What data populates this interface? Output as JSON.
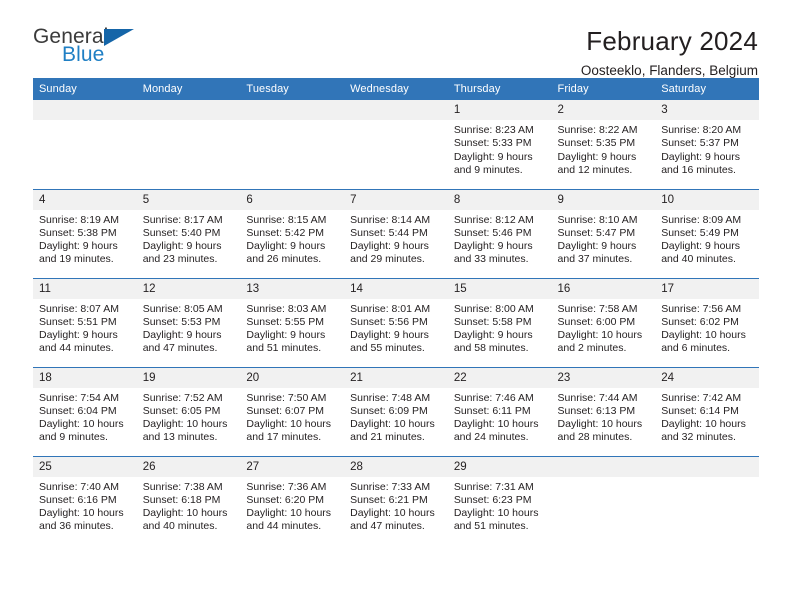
{
  "brand": {
    "name_top": "General",
    "name_bottom": "Blue",
    "flag_icon": "triangle-flag-icon",
    "color_blue": "#1f7fc4",
    "color_flag": "#1565a8"
  },
  "header": {
    "title": "February 2024",
    "subtitle": "Oosteeklo, Flanders, Belgium"
  },
  "theme": {
    "header_row_bg": "#3175b8",
    "daynum_bg": "#f1f1f1",
    "text": "#231f20"
  },
  "weekday_headers": [
    "Sunday",
    "Monday",
    "Tuesday",
    "Wednesday",
    "Thursday",
    "Friday",
    "Saturday"
  ],
  "labels": {
    "sunrise": "Sunrise:",
    "sunset": "Sunset:",
    "daylight": "Daylight:"
  },
  "weeks": [
    [
      {
        "day": "",
        "sunrise": "",
        "sunset": "",
        "daylight_line1": "",
        "daylight_line2": ""
      },
      {
        "day": "",
        "sunrise": "",
        "sunset": "",
        "daylight_line1": "",
        "daylight_line2": ""
      },
      {
        "day": "",
        "sunrise": "",
        "sunset": "",
        "daylight_line1": "",
        "daylight_line2": ""
      },
      {
        "day": "",
        "sunrise": "",
        "sunset": "",
        "daylight_line1": "",
        "daylight_line2": ""
      },
      {
        "day": "1",
        "sunrise": "Sunrise: 8:23 AM",
        "sunset": "Sunset: 5:33 PM",
        "daylight_line1": "Daylight: 9 hours",
        "daylight_line2": "and 9 minutes."
      },
      {
        "day": "2",
        "sunrise": "Sunrise: 8:22 AM",
        "sunset": "Sunset: 5:35 PM",
        "daylight_line1": "Daylight: 9 hours",
        "daylight_line2": "and 12 minutes."
      },
      {
        "day": "3",
        "sunrise": "Sunrise: 8:20 AM",
        "sunset": "Sunset: 5:37 PM",
        "daylight_line1": "Daylight: 9 hours",
        "daylight_line2": "and 16 minutes."
      }
    ],
    [
      {
        "day": "4",
        "sunrise": "Sunrise: 8:19 AM",
        "sunset": "Sunset: 5:38 PM",
        "daylight_line1": "Daylight: 9 hours",
        "daylight_line2": "and 19 minutes."
      },
      {
        "day": "5",
        "sunrise": "Sunrise: 8:17 AM",
        "sunset": "Sunset: 5:40 PM",
        "daylight_line1": "Daylight: 9 hours",
        "daylight_line2": "and 23 minutes."
      },
      {
        "day": "6",
        "sunrise": "Sunrise: 8:15 AM",
        "sunset": "Sunset: 5:42 PM",
        "daylight_line1": "Daylight: 9 hours",
        "daylight_line2": "and 26 minutes."
      },
      {
        "day": "7",
        "sunrise": "Sunrise: 8:14 AM",
        "sunset": "Sunset: 5:44 PM",
        "daylight_line1": "Daylight: 9 hours",
        "daylight_line2": "and 29 minutes."
      },
      {
        "day": "8",
        "sunrise": "Sunrise: 8:12 AM",
        "sunset": "Sunset: 5:46 PM",
        "daylight_line1": "Daylight: 9 hours",
        "daylight_line2": "and 33 minutes."
      },
      {
        "day": "9",
        "sunrise": "Sunrise: 8:10 AM",
        "sunset": "Sunset: 5:47 PM",
        "daylight_line1": "Daylight: 9 hours",
        "daylight_line2": "and 37 minutes."
      },
      {
        "day": "10",
        "sunrise": "Sunrise: 8:09 AM",
        "sunset": "Sunset: 5:49 PM",
        "daylight_line1": "Daylight: 9 hours",
        "daylight_line2": "and 40 minutes."
      }
    ],
    [
      {
        "day": "11",
        "sunrise": "Sunrise: 8:07 AM",
        "sunset": "Sunset: 5:51 PM",
        "daylight_line1": "Daylight: 9 hours",
        "daylight_line2": "and 44 minutes."
      },
      {
        "day": "12",
        "sunrise": "Sunrise: 8:05 AM",
        "sunset": "Sunset: 5:53 PM",
        "daylight_line1": "Daylight: 9 hours",
        "daylight_line2": "and 47 minutes."
      },
      {
        "day": "13",
        "sunrise": "Sunrise: 8:03 AM",
        "sunset": "Sunset: 5:55 PM",
        "daylight_line1": "Daylight: 9 hours",
        "daylight_line2": "and 51 minutes."
      },
      {
        "day": "14",
        "sunrise": "Sunrise: 8:01 AM",
        "sunset": "Sunset: 5:56 PM",
        "daylight_line1": "Daylight: 9 hours",
        "daylight_line2": "and 55 minutes."
      },
      {
        "day": "15",
        "sunrise": "Sunrise: 8:00 AM",
        "sunset": "Sunset: 5:58 PM",
        "daylight_line1": "Daylight: 9 hours",
        "daylight_line2": "and 58 minutes."
      },
      {
        "day": "16",
        "sunrise": "Sunrise: 7:58 AM",
        "sunset": "Sunset: 6:00 PM",
        "daylight_line1": "Daylight: 10 hours",
        "daylight_line2": "and 2 minutes."
      },
      {
        "day": "17",
        "sunrise": "Sunrise: 7:56 AM",
        "sunset": "Sunset: 6:02 PM",
        "daylight_line1": "Daylight: 10 hours",
        "daylight_line2": "and 6 minutes."
      }
    ],
    [
      {
        "day": "18",
        "sunrise": "Sunrise: 7:54 AM",
        "sunset": "Sunset: 6:04 PM",
        "daylight_line1": "Daylight: 10 hours",
        "daylight_line2": "and 9 minutes."
      },
      {
        "day": "19",
        "sunrise": "Sunrise: 7:52 AM",
        "sunset": "Sunset: 6:05 PM",
        "daylight_line1": "Daylight: 10 hours",
        "daylight_line2": "and 13 minutes."
      },
      {
        "day": "20",
        "sunrise": "Sunrise: 7:50 AM",
        "sunset": "Sunset: 6:07 PM",
        "daylight_line1": "Daylight: 10 hours",
        "daylight_line2": "and 17 minutes."
      },
      {
        "day": "21",
        "sunrise": "Sunrise: 7:48 AM",
        "sunset": "Sunset: 6:09 PM",
        "daylight_line1": "Daylight: 10 hours",
        "daylight_line2": "and 21 minutes."
      },
      {
        "day": "22",
        "sunrise": "Sunrise: 7:46 AM",
        "sunset": "Sunset: 6:11 PM",
        "daylight_line1": "Daylight: 10 hours",
        "daylight_line2": "and 24 minutes."
      },
      {
        "day": "23",
        "sunrise": "Sunrise: 7:44 AM",
        "sunset": "Sunset: 6:13 PM",
        "daylight_line1": "Daylight: 10 hours",
        "daylight_line2": "and 28 minutes."
      },
      {
        "day": "24",
        "sunrise": "Sunrise: 7:42 AM",
        "sunset": "Sunset: 6:14 PM",
        "daylight_line1": "Daylight: 10 hours",
        "daylight_line2": "and 32 minutes."
      }
    ],
    [
      {
        "day": "25",
        "sunrise": "Sunrise: 7:40 AM",
        "sunset": "Sunset: 6:16 PM",
        "daylight_line1": "Daylight: 10 hours",
        "daylight_line2": "and 36 minutes."
      },
      {
        "day": "26",
        "sunrise": "Sunrise: 7:38 AM",
        "sunset": "Sunset: 6:18 PM",
        "daylight_line1": "Daylight: 10 hours",
        "daylight_line2": "and 40 minutes."
      },
      {
        "day": "27",
        "sunrise": "Sunrise: 7:36 AM",
        "sunset": "Sunset: 6:20 PM",
        "daylight_line1": "Daylight: 10 hours",
        "daylight_line2": "and 44 minutes."
      },
      {
        "day": "28",
        "sunrise": "Sunrise: 7:33 AM",
        "sunset": "Sunset: 6:21 PM",
        "daylight_line1": "Daylight: 10 hours",
        "daylight_line2": "and 47 minutes."
      },
      {
        "day": "29",
        "sunrise": "Sunrise: 7:31 AM",
        "sunset": "Sunset: 6:23 PM",
        "daylight_line1": "Daylight: 10 hours",
        "daylight_line2": "and 51 minutes."
      },
      {
        "day": "",
        "sunrise": "",
        "sunset": "",
        "daylight_line1": "",
        "daylight_line2": ""
      },
      {
        "day": "",
        "sunrise": "",
        "sunset": "",
        "daylight_line1": "",
        "daylight_line2": ""
      }
    ]
  ]
}
